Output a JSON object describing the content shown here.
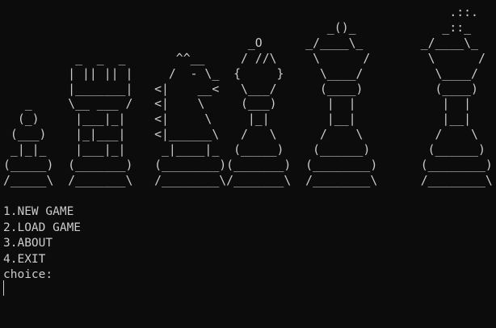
{
  "console": {
    "background_color": "#0c0c0c",
    "text_color": "#cccccc",
    "ascii_art": "                                                              .::.\n                                             _()_            _::_\n                                  _O      _/____\\_        _/____\\_\n          _  _  _       ^^__     / //\\     \\      /        \\      /\n         | || || |     /  - \\_  {     }     \\____/          \\____/\n         |_______|   <|    __<   \\___/      (____)          (____)\n   _     \\__ ___ /   <|    \\     (___)       |  |            |  |\n  (_)     |___|_|    <|     \\     |_|        |__|            |__|\n (___)    |_|___|    <|______\\   /   \\      /    \\          /    \\\n _|_|_    |___|_|     _|____|_  (_____)    (______)        (______)\n(_____)  (_______)   (________)(_______)  (________)      (________)\n/_____\\  /_______\\   /________\\/_______\\  /________\\      /________\\",
    "menu": {
      "item_new_game": "1.NEW GAME",
      "item_load_game": "2.LOAD GAME",
      "item_about": "3.ABOUT",
      "item_exit": "4.EXIT"
    },
    "prompt": "choice:"
  }
}
